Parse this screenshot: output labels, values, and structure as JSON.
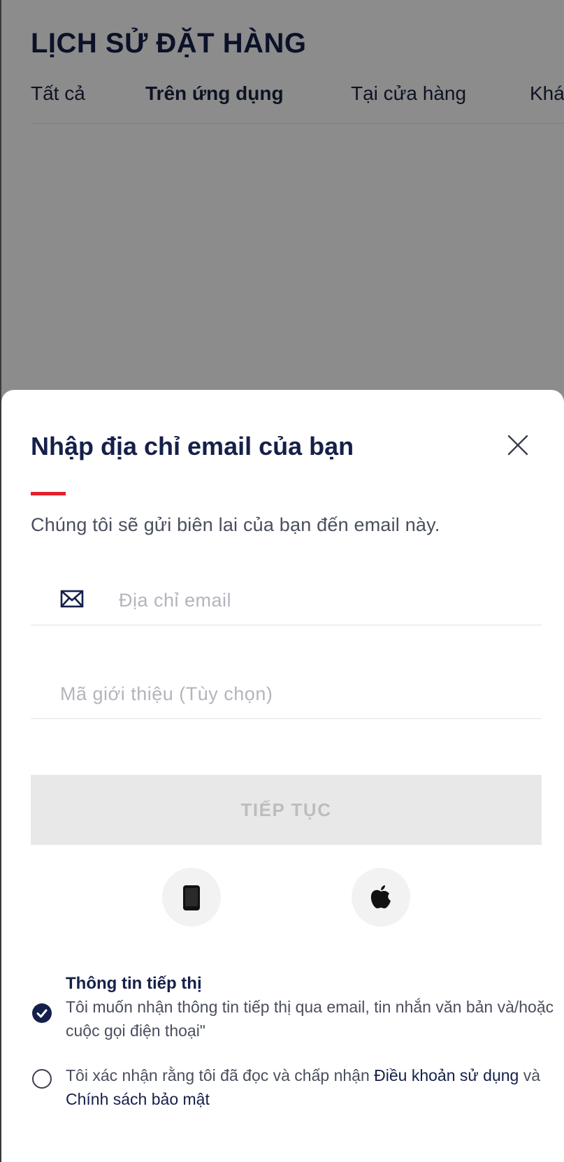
{
  "background_page": {
    "title": "LỊCH SỬ ĐẶT HÀNG",
    "tabs": [
      {
        "label": "Tất cả",
        "active": false
      },
      {
        "label": "Trên ứng dụng",
        "active": true
      },
      {
        "label": "Tại cửa hàng",
        "active": false
      },
      {
        "label": "Khá",
        "active": false
      }
    ]
  },
  "sheet": {
    "title": "Nhập địa chỉ email của bạn",
    "subtitle": "Chúng tôi sẽ gửi biên lai của bạn đến email này.",
    "email_field": {
      "value": "",
      "placeholder": "Địa chỉ email"
    },
    "referral_field": {
      "value": "",
      "placeholder": "Mã giới thiệu (Tùy chọn)"
    },
    "continue_label": "TIẾP TỤC",
    "social": [
      {
        "icon": "phone-icon"
      },
      {
        "icon": "apple-icon"
      }
    ],
    "marketing": {
      "title": "Thông tin tiếp thị",
      "text": "Tôi muốn nhận thông tin tiếp thị qua email, tin nhắn văn bản và/hoặc cuộc gọi điện thoại\"",
      "checked": true
    },
    "terms": {
      "text_before": "Tôi xác nhận rằng tôi đã đọc và chấp nhận ",
      "terms_link": "Điều khoản sử dụng",
      "text_middle": " và ",
      "privacy_link": "Chính sách bảo mật",
      "checked": false
    }
  },
  "colors": {
    "navy": "#15204a",
    "accent_red": "#e4202a",
    "button_disabled_bg": "#e8e8e8",
    "button_disabled_text": "#bdbdbd"
  }
}
